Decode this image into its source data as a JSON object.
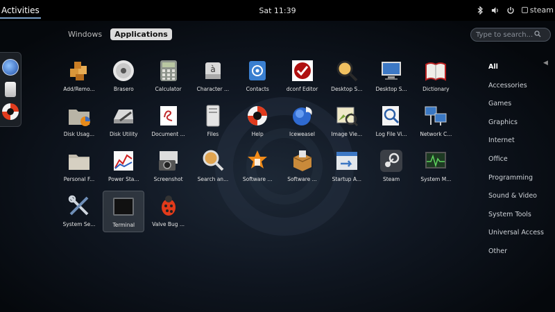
{
  "topbar": {
    "activities": "Activities",
    "clock": "Sat 11:39",
    "tray": {
      "steam_label": "steam"
    }
  },
  "switcher": {
    "tabs": [
      "Windows",
      "Applications"
    ]
  },
  "search": {
    "placeholder": "Type to search..."
  },
  "apps": [
    {
      "label": "Add/Remo...",
      "icon": "package-icon"
    },
    {
      "label": "Brasero",
      "icon": "disc-icon"
    },
    {
      "label": "Calculator",
      "icon": "calculator-icon"
    },
    {
      "label": "Character ...",
      "icon": "character-map-icon"
    },
    {
      "label": "Contacts",
      "icon": "contacts-icon"
    },
    {
      "label": "dconf Editor",
      "icon": "dconf-icon"
    },
    {
      "label": "Desktop S...",
      "icon": "magnifier-icon"
    },
    {
      "label": "Desktop S...",
      "icon": "desktop-sharing-icon"
    },
    {
      "label": "Dictionary",
      "icon": "book-icon"
    },
    {
      "label": "Disk Usag...",
      "icon": "folder-chart-icon"
    },
    {
      "label": "Disk Utility",
      "icon": "disk-utility-icon"
    },
    {
      "label": "Document ...",
      "icon": "document-viewer-icon"
    },
    {
      "label": "Files",
      "icon": "files-icon"
    },
    {
      "label": "Help",
      "icon": "lifebuoy-icon"
    },
    {
      "label": "Iceweasel",
      "icon": "iceweasel-icon"
    },
    {
      "label": "Image Vie...",
      "icon": "image-viewer-icon"
    },
    {
      "label": "Log File Vi...",
      "icon": "log-viewer-icon"
    },
    {
      "label": "Network C...",
      "icon": "network-icon"
    },
    {
      "label": "Personal F...",
      "icon": "folder-icon"
    },
    {
      "label": "Power Sta...",
      "icon": "power-stats-icon"
    },
    {
      "label": "Screenshot",
      "icon": "camera-icon"
    },
    {
      "label": "Search an...",
      "icon": "search-find-icon"
    },
    {
      "label": "Software ...",
      "icon": "software-star-icon"
    },
    {
      "label": "Software ...",
      "icon": "software-box-icon"
    },
    {
      "label": "Startup A...",
      "icon": "startup-icon"
    },
    {
      "label": "Steam",
      "icon": "steam-icon"
    },
    {
      "label": "System M...",
      "icon": "system-monitor-icon"
    },
    {
      "label": "System Se...",
      "icon": "system-settings-icon"
    },
    {
      "label": "Terminal",
      "icon": "terminal-icon"
    },
    {
      "label": "Valve Bug ...",
      "icon": "bug-icon"
    }
  ],
  "categories": [
    "All",
    "Accessories",
    "Games",
    "Graphics",
    "Internet",
    "Office",
    "Programming",
    "Sound & Video",
    "System Tools",
    "Universal Access",
    "Other"
  ],
  "colors": {
    "accent": "#7aa0c8",
    "panel": "#000000"
  }
}
